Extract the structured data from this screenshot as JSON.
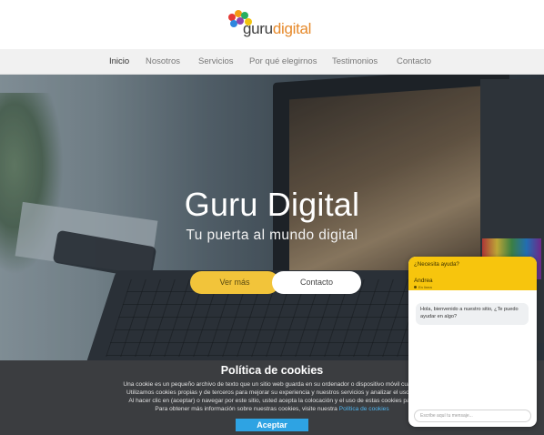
{
  "brand": {
    "logo_text_part1": "guru",
    "logo_text_part2": "digital",
    "colors": {
      "logo_dots": [
        "#e53935",
        "#f39c12",
        "#27ae60",
        "#2e86de",
        "#8e44ad",
        "#f1c40f"
      ],
      "accent_orange": "#e6892a",
      "accent_yellow": "#f2c43a"
    }
  },
  "nav": {
    "items": [
      {
        "label": "Inicio",
        "active": true
      },
      {
        "label": "Nosotros"
      },
      {
        "label": "Servicios"
      },
      {
        "label": "Por qué elegirnos"
      },
      {
        "label": "Testimonios"
      },
      {
        "label": "Contacto"
      }
    ]
  },
  "hero": {
    "title": "Guru Digital",
    "subtitle": "Tu puerta al mundo digital",
    "primary_button": "Ver más",
    "secondary_button": "Contacto"
  },
  "cookies": {
    "title": "Política de cookies",
    "line1": "Una cookie es un pequeño archivo de texto que un sitio web guarda en su ordenador o dispositivo móvil cuando",
    "line2": "Utilizamos cookies propias y de terceros para mejorar su experiencia y nuestros servicios y analizar el uso de",
    "line3": "Al hacer clic en (aceptar) o navegar por este sitio, usted acepta la colocación y el uso de estas cookies para",
    "line4_text": "Para obtener más información sobre nuestras cookies, visite nuestra",
    "line4_link": "Política de cookies",
    "accept_button": "Aceptar"
  },
  "chat": {
    "header_question": "¿Necesita ayuda?",
    "agent_name": "Andrea",
    "agent_status": "En línea",
    "message": "Hola, bienvenido a nuestro sitio, ¿Te puedo ayudar en algo?",
    "input_placeholder": "Escribe aquí tu mensaje..."
  }
}
